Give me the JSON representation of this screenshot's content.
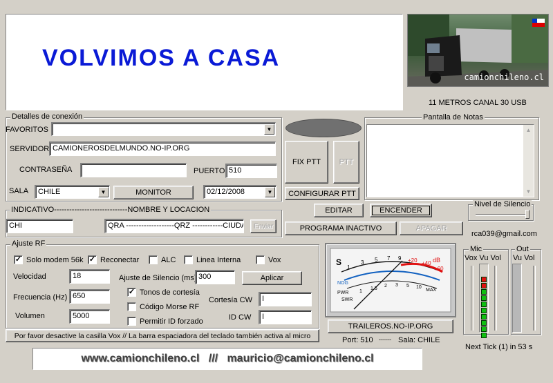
{
  "banner": {
    "title": "VOLVIMOS A CASA"
  },
  "logo": {
    "brand": "camionchileno.cl"
  },
  "band_info": "11 METROS CANAL 30 USB",
  "connection": {
    "group_title": "Detalles de conexión",
    "favoritos_label": "FAVORITOS",
    "favoritos_value": "",
    "servidor_label": "SERVIDOR",
    "servidor_value": "CAMIONEROSDELMUNDO.NO-IP.ORG",
    "password_label": "CONTRASEÑA",
    "password_value": "",
    "puerto_label": "PUERTO",
    "puerto_value": "510",
    "sala_label": "SALA",
    "sala_value": "CHILE",
    "monitor_button": "MONITOR",
    "date_value": "02/12/2008"
  },
  "ptt": {
    "fix_ptt": "FIX PTT",
    "ptt": "PTT",
    "configurar": "CONFIGURAR PTT"
  },
  "notes": {
    "title": "Pantalla de Notas",
    "content": ""
  },
  "identity": {
    "header": "INDICATIVO-----------------------------NOMBRE Y LOCACION",
    "indicativo_value": "CHI",
    "location_value": "QRA -------------------QRZ  ------------CIUDAD",
    "enviar_button": "Enviar"
  },
  "actions": {
    "editar": "EDITAR",
    "encender": "ENCENDER",
    "programa_inactivo": "PROGRAMA INACTIVO",
    "apagar": "APAGAR"
  },
  "silence_level": {
    "title": "Nivel de Silencio",
    "level": 0.95
  },
  "email": "rca039@gmail.com",
  "rf": {
    "group_title": "Ajuste RF",
    "checkboxes": [
      {
        "label": "Solo modem 56k",
        "checked": true
      },
      {
        "label": "Reconectar",
        "checked": true
      },
      {
        "label": "ALC",
        "checked": false
      },
      {
        "label": "Linea Interna",
        "checked": false
      },
      {
        "label": "Vox",
        "checked": false
      }
    ],
    "velocidad_label": "Velocidad",
    "velocidad_value": "18",
    "frecuencia_label": "Frecuencia (Hz)",
    "frecuencia_value": "650",
    "volumen_label": "Volumen",
    "volumen_value": "5000",
    "silencio_label": "Ajuste de Silencio (ms)",
    "silencio_value": "300",
    "aplicar_button": "Aplicar",
    "tonos_label": "Tonos de cortesía",
    "tonos_checked": true,
    "morse_label": "Código Morse RF",
    "morse_checked": false,
    "permitir_label": "Permitir ID forzado",
    "permitir_checked": false,
    "cortesia_cw_label": "Cortesía CW",
    "cortesia_cw_value": "I",
    "id_cw_label": "ID CW",
    "id_cw_value": "I"
  },
  "meter": {
    "scale_s": "S",
    "scale_db": "dB",
    "labels": [
      "1",
      "3",
      "5",
      "7",
      "9",
      "+20",
      "+40",
      "+60"
    ],
    "labels_lower": [
      "1",
      "1.5",
      "2",
      "3",
      "5",
      "10",
      "MAX"
    ],
    "pwr": "PWR",
    "swr": "SWR",
    "noise": "NOG"
  },
  "server_button": "TRAILEROS.NO-IP.ORG",
  "status": {
    "port": "Port: 510",
    "sep": "------",
    "room": "Sala: CHILE"
  },
  "levels": {
    "mic_title": "Mic",
    "out_title": "Out",
    "mic_cols": "Vox  Vu  Vol",
    "out_cols": "Vu  Vol",
    "mic_vu_red": 2,
    "mic_vu_green": 8
  },
  "next_tick": "Next Tick (1) in 53 s",
  "hint": "Por favor desactive la casilla Vox // La barra espaciadora del teclado también activa al micro",
  "footer": "www.camionchileno.cl   ///   mauricio@camionchileno.cl",
  "colors": {
    "title_blue": "#0a1ad6",
    "meter_red": "#e01010",
    "meter_green": "#10c010"
  }
}
